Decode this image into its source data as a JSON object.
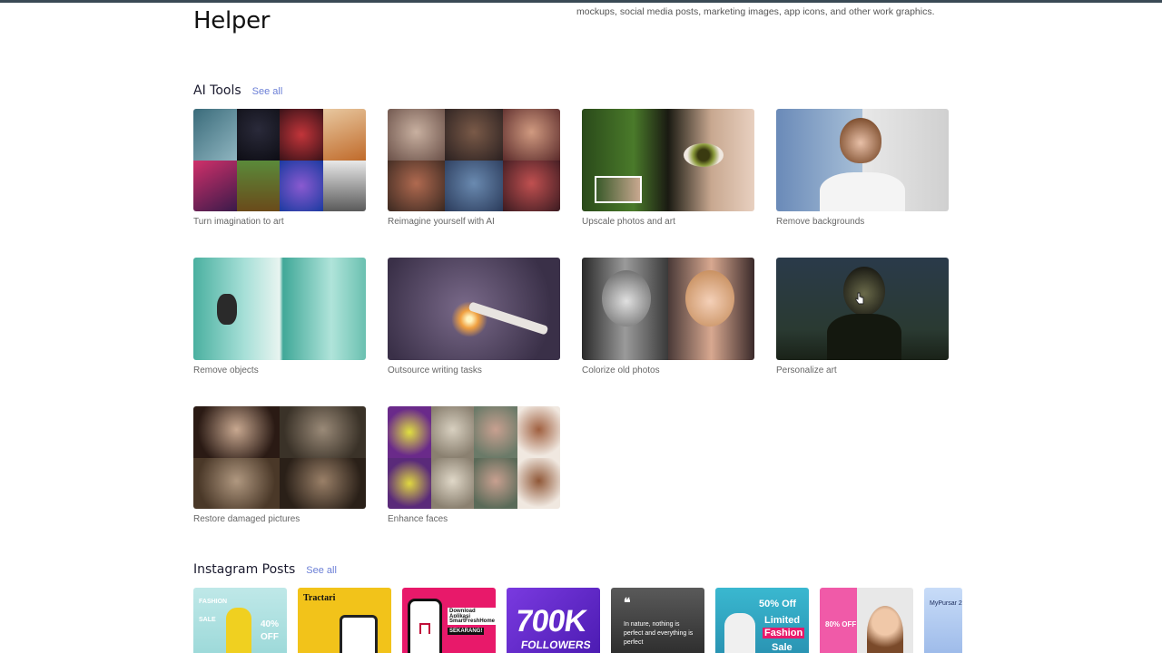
{
  "header": {
    "title": "Helper",
    "description": "mockups, social media posts, marketing images, app icons, and other work graphics."
  },
  "ai_tools": {
    "title": "AI Tools",
    "see_all": "See all",
    "items": [
      {
        "label": "Turn imagination to art"
      },
      {
        "label": "Reimagine yourself with AI"
      },
      {
        "label": "Upscale photos and art"
      },
      {
        "label": "Remove backgrounds"
      },
      {
        "label": "Remove objects"
      },
      {
        "label": "Outsource writing tasks"
      },
      {
        "label": "Colorize old photos"
      },
      {
        "label": "Personalize art"
      },
      {
        "label": "Restore damaged pictures"
      },
      {
        "label": "Enhance faces"
      }
    ]
  },
  "instagram": {
    "title": "Instagram Posts",
    "see_all": "See all",
    "cards": [
      {
        "text1": "FASHION",
        "text2": "SALE",
        "text3": "40% OFF"
      },
      {
        "text1": "Tractari"
      },
      {
        "text1": "Download Aplikasi",
        "text2": "SmartFreshHome",
        "text3": "SEKARANG!"
      },
      {
        "text1": "700K",
        "text2": "FOLLOWERS"
      },
      {
        "text1": "In nature, nothing is perfect and everything is perfect"
      },
      {
        "text1": "50% Off",
        "text2": "Limited",
        "text3": "Fashion",
        "text4": "Sale"
      },
      {
        "text1": "80% OFF"
      },
      {
        "text1": "MyPursar 2"
      }
    ]
  },
  "colors": {
    "accent_link": "#6b7fd6",
    "topbar": "#3a4a55"
  }
}
